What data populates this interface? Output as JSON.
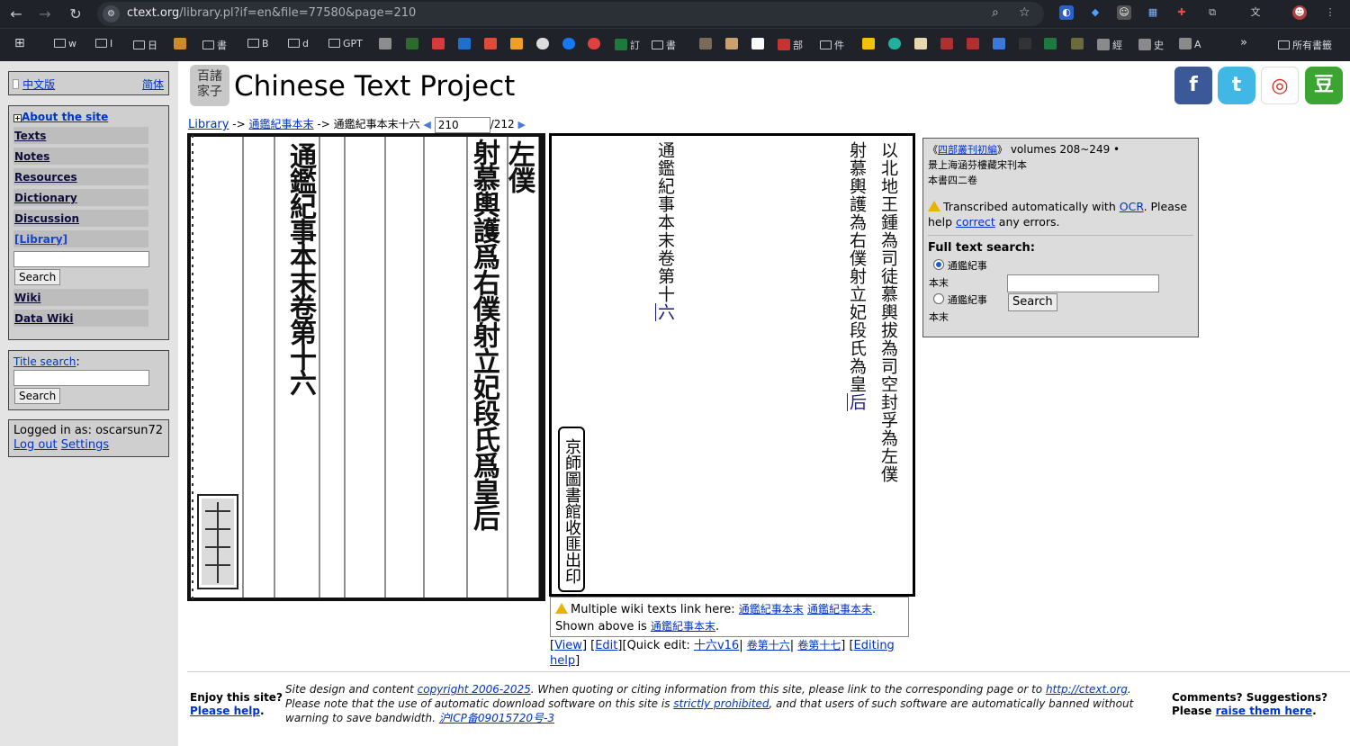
{
  "browser": {
    "url_host": "ctext.org",
    "url_path": "/library.pl?if=en&file=77580&page=210",
    "bookmarks": [
      {
        "label": "w"
      },
      {
        "label": "I"
      },
      {
        "label": "日"
      },
      {
        "label": "書"
      },
      {
        "label": "B"
      },
      {
        "label": "d"
      },
      {
        "label": "GPT"
      },
      {
        "label": "訂"
      },
      {
        "label": "書"
      },
      {
        "label": "部"
      },
      {
        "label": "件"
      },
      {
        "label": "經"
      },
      {
        "label": "史"
      },
      {
        "label": "A"
      },
      {
        "label": "所有書籤"
      }
    ]
  },
  "sidebar": {
    "lang_zh": "中文版",
    "lang_simplified": "简体",
    "about": "About the site",
    "nav": [
      "Texts",
      "Notes",
      "Resources",
      "Dictionary",
      "Discussion",
      "[Library]"
    ],
    "search_button": "Search",
    "nav2": [
      "Wiki",
      "Data Wiki"
    ],
    "title_search_label": "Title search",
    "title_search_button": "Search",
    "logged_in_text": "Logged in as: oscarsun72",
    "logout": "Log out",
    "settings": "Settings"
  },
  "header": {
    "logo_top": "百諸",
    "logo_bottom": "家子",
    "title": "Chinese Text Project"
  },
  "breadcrumb": {
    "library": "Library",
    "sep": "->",
    "book": "通鑑紀事本末",
    "chapter": "通鑑紀事本末十六",
    "page_value": "210",
    "page_total": "/212"
  },
  "scan": {
    "col1": "以北地王鍾爲司徒慕輿拔爲司空封孚爲左僕",
    "col2": "射慕輿護爲右僕射立妃段氏爲皇后",
    "col3": "通鑑紀事本末卷第十六"
  },
  "transcription": {
    "col1": "以北地王鍾為司徒慕輿拔為司空封孚為左僕",
    "col2_main": "射慕輿護為右僕射立妃段氏為皇",
    "col2_link": "后",
    "col3_main": "通鑑紀事本末卷第十",
    "col3_link": "六",
    "seal": "京師圖書館收匪出印"
  },
  "wiki_note": {
    "prefix": "Multiple wiki texts link here:",
    "link1": "通鑑紀事本末",
    "link2": "通鑑紀事本末",
    "shown_prefix": "Shown above is",
    "shown_link": "通鑑紀事本末"
  },
  "edit_line": {
    "view": "View",
    "edit": "Edit",
    "quick_edit": "Quick edit:",
    "q1": "十六v16",
    "q2": "卷第十六",
    "q3": "卷第十七",
    "editing": "Editing",
    "help": "help"
  },
  "infobox": {
    "series_link": "四部叢刊初編",
    "volumes": "volumes 208~249",
    "source_line1": "景上海涵芬樓藏宋刊本",
    "source_line2": "本書四二卷",
    "ocr_prefix": "Transcribed automatically with",
    "ocr_link": "OCR",
    "ocr_mid": ". Please help",
    "correct_link": "correct",
    "ocr_suffix": "any errors.",
    "fulltext_label": "Full text search:",
    "opt1": "通鑑紀事",
    "opt1b": "本末",
    "opt2": "通鑑紀事",
    "opt2b": "本末",
    "search_button": "Search"
  },
  "footer": {
    "enjoy": "Enjoy this site?",
    "please_help": "Please help",
    "mid_1": "Site design and content",
    "copyright_link": "copyright 2006-2025",
    "mid_2": ". When quoting or citing information from this site, please link to the corresponding page or to",
    "site_link": "http://ctext.org",
    "mid_3": ". Please note that the use of automatic download software on this site is",
    "prohibited_link": "strictly prohibited",
    "mid_4": ", and that users of such software are automatically banned without warning to save bandwidth.",
    "icp_link": "沪ICP备09015720号-3",
    "comments": "Comments? Suggestions?",
    "please": "Please",
    "raise_link": "raise them here"
  },
  "colors": {
    "chrome_bg": "#1f2329",
    "sidebar_bg": "#e4e4e4",
    "link": "#0033cc",
    "nav_item_bg": "#bdbdbd"
  }
}
